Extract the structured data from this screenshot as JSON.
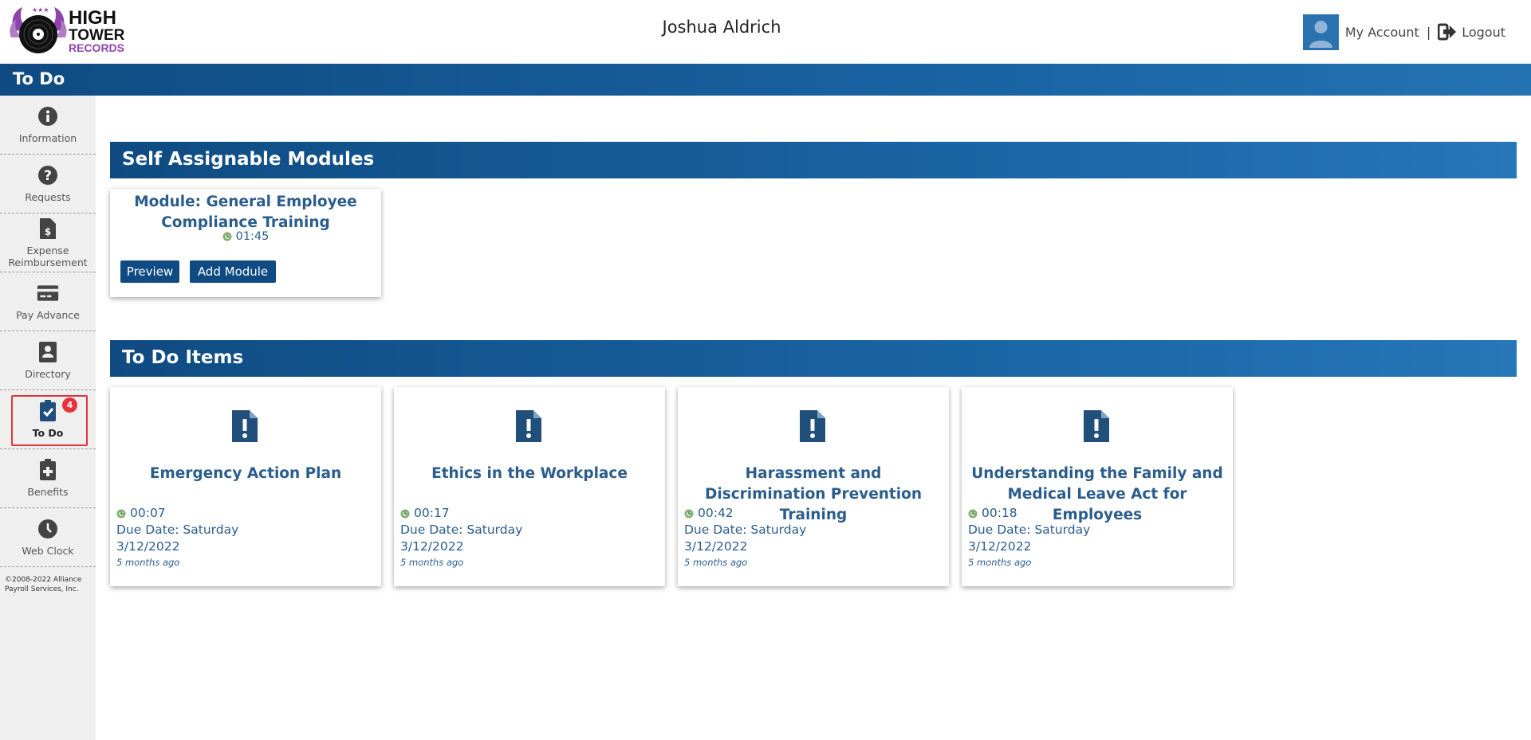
{
  "header": {
    "logo_text": [
      "HIGH",
      "TOWER",
      "RECORDS"
    ],
    "user_name": "Joshua Aldrich",
    "my_account": "My Account",
    "separator": "|",
    "logout": "Logout"
  },
  "page": {
    "title": "To Do"
  },
  "sidebar": {
    "items": [
      {
        "label": "Information",
        "icon": "info-icon"
      },
      {
        "label": "Requests",
        "icon": "question-icon"
      },
      {
        "label": "Expense Reimbursement",
        "icon": "expense-icon"
      },
      {
        "label": "Pay Advance",
        "icon": "credit-card-icon"
      },
      {
        "label": "Directory",
        "icon": "contact-book-icon"
      },
      {
        "label": "To Do",
        "icon": "clipboard-check-icon",
        "badge": "4",
        "active": true
      },
      {
        "label": "Benefits",
        "icon": "medical-clipboard-icon"
      },
      {
        "label": "Web Clock",
        "icon": "clock-icon"
      }
    ],
    "copyright": "©2008-2022 Alliance Payroll Services, Inc."
  },
  "self_assignable": {
    "heading": "Self Assignable Modules",
    "module": {
      "title": "Module: General Employee Compliance Training",
      "duration": "01:45",
      "preview": "Preview",
      "add": "Add Module"
    }
  },
  "todo": {
    "heading": "To Do Items",
    "items": [
      {
        "title": "Emergency Action Plan",
        "duration": "00:07",
        "due_label": "Due Date: Saturday",
        "due_date": "3/12/2022",
        "ago": "5 months ago"
      },
      {
        "title": "Ethics in the Workplace",
        "duration": "00:17",
        "due_label": "Due Date: Saturday",
        "due_date": "3/12/2022",
        "ago": "5 months ago"
      },
      {
        "title": "Harassment and Discrimination Prevention Training",
        "duration": "00:42",
        "due_label": "Due Date: Saturday",
        "due_date": "3/12/2022",
        "ago": "5 months ago"
      },
      {
        "title": "Understanding the Family and Medical Leave Act for Employees",
        "duration": "00:18",
        "due_label": "Due Date: Saturday",
        "due_date": "3/12/2022",
        "ago": "5 months ago"
      }
    ]
  },
  "colors": {
    "brand_blue": "#0f4b82",
    "text_blue": "#2a5d8c",
    "badge_red": "#e8323a",
    "logo_purple": "#8e44ad"
  }
}
